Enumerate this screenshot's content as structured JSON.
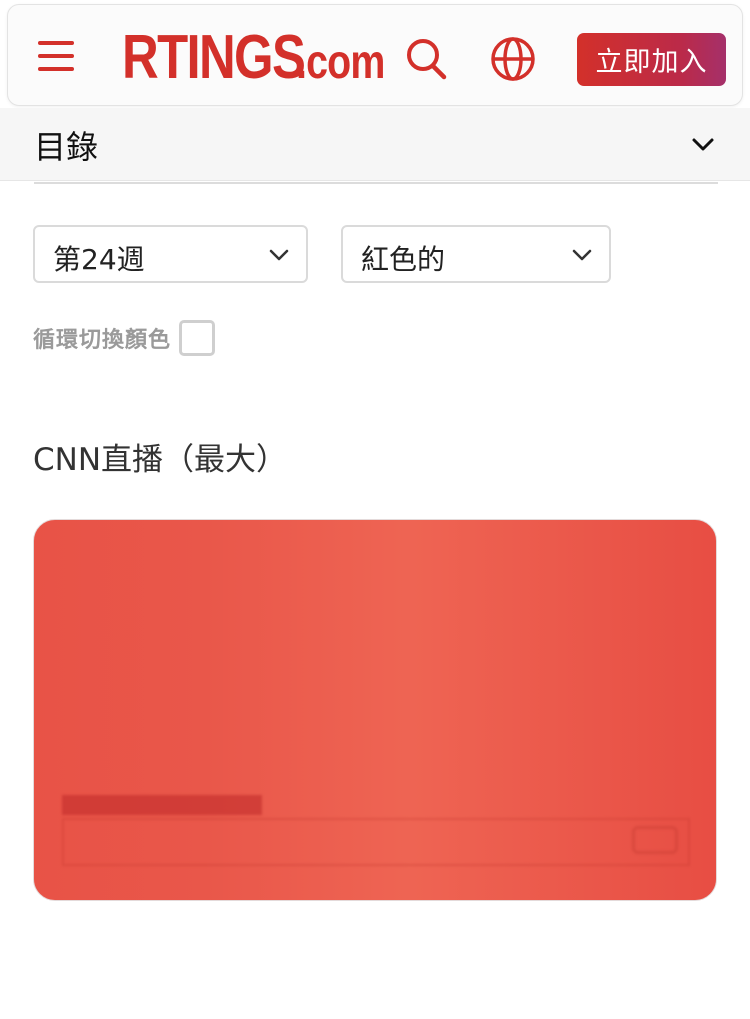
{
  "header": {
    "logo_main": "RTINGS",
    "logo_suffix": ".com",
    "join_label": "立即加入",
    "menu_icon": "hamburger-menu-icon",
    "search_icon": "search-icon",
    "globe_icon": "globe-icon"
  },
  "toc": {
    "label": "目錄",
    "icon": "chevron-down-icon"
  },
  "controls": {
    "week_select": "第24週",
    "color_select": "紅色的",
    "cycle_label": "循環切換顏色",
    "cycle_checked": false
  },
  "section": {
    "title": "CNN直播（最大）"
  },
  "colors": {
    "brand": "#d3302a",
    "preview_fill": "#e9574a"
  }
}
